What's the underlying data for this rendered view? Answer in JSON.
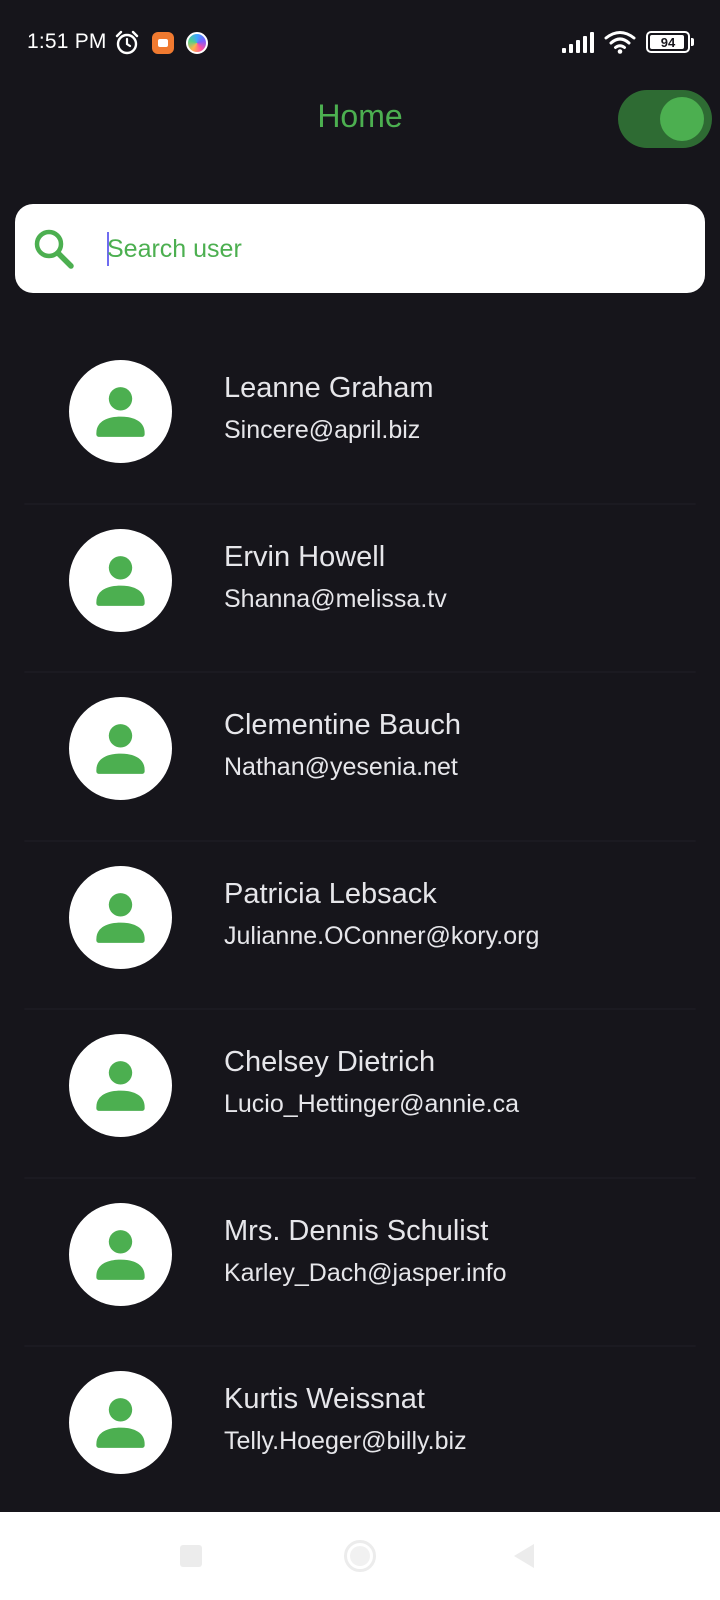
{
  "status_bar": {
    "time": "1:51 PM",
    "battery_percent": "94",
    "icons": [
      "alarm-icon",
      "screen-recorder-icon",
      "color-app-icon",
      "signal-icon",
      "wifi-icon",
      "battery-icon"
    ]
  },
  "app_bar": {
    "title": "Home",
    "theme_toggle_on": true
  },
  "search": {
    "placeholder": "Search user",
    "value": ""
  },
  "users": [
    {
      "name": "Leanne Graham",
      "email": "Sincere@april.biz"
    },
    {
      "name": "Ervin Howell",
      "email": "Shanna@melissa.tv"
    },
    {
      "name": "Clementine Bauch",
      "email": "Nathan@yesenia.net"
    },
    {
      "name": "Patricia Lebsack",
      "email": "Julianne.OConner@kory.org"
    },
    {
      "name": "Chelsey Dietrich",
      "email": "Lucio_Hettinger@annie.ca"
    },
    {
      "name": "Mrs. Dennis Schulist",
      "email": "Karley_Dach@jasper.info"
    },
    {
      "name": "Kurtis Weissnat",
      "email": "Telly.Hoeger@billy.biz"
    }
  ],
  "colors": {
    "accent": "#4caf50",
    "background": "#16151b",
    "text": "#e6e6ea",
    "toggle_track": "#2e6b33"
  }
}
